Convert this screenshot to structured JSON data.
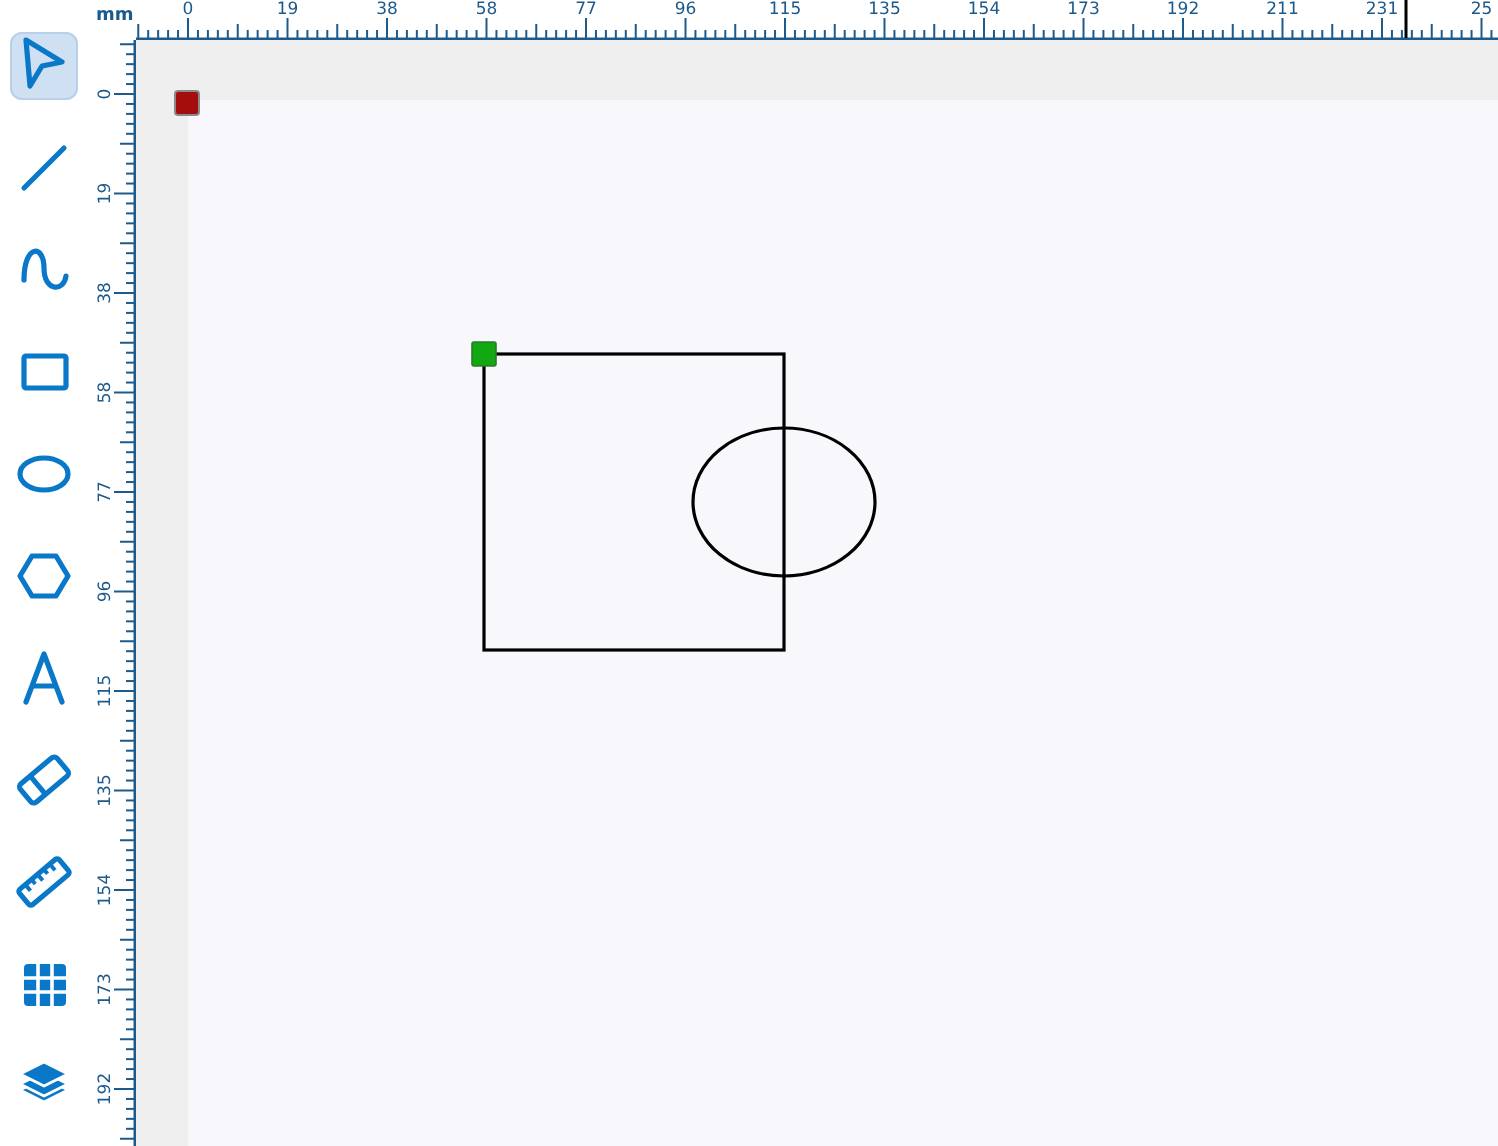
{
  "toolbar": {
    "tools": [
      {
        "kind": "select",
        "selected": true
      },
      {
        "kind": "line",
        "selected": false
      },
      {
        "kind": "curve",
        "selected": false
      },
      {
        "kind": "rectangle",
        "selected": false
      },
      {
        "kind": "ellipse",
        "selected": false
      },
      {
        "kind": "polygon",
        "selected": false
      },
      {
        "kind": "text",
        "selected": false
      },
      {
        "kind": "eraser",
        "selected": false
      },
      {
        "kind": "measure",
        "selected": false
      },
      {
        "kind": "grid",
        "selected": false
      },
      {
        "kind": "layers",
        "selected": false
      }
    ]
  },
  "rulers": {
    "unit": "mm",
    "top_labels": [
      "0",
      "19",
      "38",
      "58",
      "77",
      "96",
      "115",
      "135",
      "154",
      "173",
      "192",
      "211",
      "231",
      "25"
    ],
    "left_labels": [
      "0",
      "19",
      "38",
      "58",
      "77",
      "96",
      "115",
      "135",
      "154",
      "173",
      "192"
    ]
  },
  "canvas": {
    "shapes": [
      {
        "kind": "rectangle",
        "selected": true
      },
      {
        "kind": "ellipse",
        "selected": false
      }
    ]
  }
}
